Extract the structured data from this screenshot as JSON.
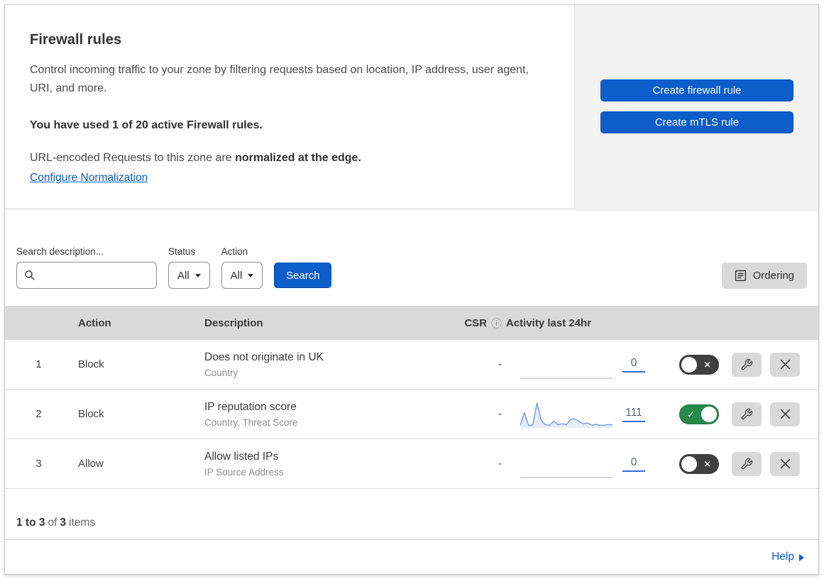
{
  "header": {
    "title": "Firewall rules",
    "description": "Control incoming traffic to your zone by filtering requests based on location, IP address, user agent, URI, and more.",
    "usage_text": "You have used 1 of 20 active Firewall rules.",
    "normalization_text": "URL-encoded Requests to this zone are ",
    "normalization_bold": "normalized at the edge.",
    "normalization_link": "Configure Normalization",
    "create_firewall_button": "Create firewall rule",
    "create_mtls_button": "Create mTLS rule"
  },
  "filters": {
    "search_label": "Search description...",
    "status_label": "Status",
    "status_value": "All",
    "action_label": "Action",
    "action_value": "All",
    "search_button": "Search",
    "ordering_button": "Ordering"
  },
  "table": {
    "headers": {
      "action": "Action",
      "description": "Description",
      "csr": "CSR",
      "activity": "Activity last 24hr"
    },
    "rows": [
      {
        "number": "1",
        "action": "Block",
        "description": "Does not originate in UK",
        "fields": "Country",
        "csr": "-",
        "activity_count": "0",
        "enabled": false,
        "sparkline": []
      },
      {
        "number": "2",
        "action": "Block",
        "description": "IP reputation score",
        "fields": "Country, Threat Score",
        "csr": "-",
        "activity_count": "111",
        "enabled": true,
        "sparkline": [
          8,
          60,
          6,
          10,
          100,
          28,
          10,
          8,
          25,
          10,
          14,
          10,
          33,
          34,
          24,
          14,
          18,
          8,
          12,
          8,
          8,
          11,
          9
        ]
      },
      {
        "number": "3",
        "action": "Allow",
        "description": "Allow listed IPs",
        "fields": "IP Source Address",
        "csr": "-",
        "activity_count": "0",
        "enabled": false,
        "sparkline": []
      }
    ]
  },
  "footer": {
    "range_bold": "1 to 3",
    "of_text": "of",
    "total_bold": "3",
    "items_text": "items",
    "help_link": "Help"
  },
  "icons": {
    "toggle_on_glyph": "✓",
    "toggle_off_glyph": "✕"
  },
  "colors": {
    "accent_blue": "#0d5dcb",
    "toggle_on_green": "#278a4b",
    "toggle_off_dark": "#3f3f3f",
    "panel_gray": "#f2f2f2",
    "table_header_gray": "#d9d9d9",
    "sparkline_blue": "#6e9bdf",
    "flatline_gray": "#c9c9c9"
  }
}
